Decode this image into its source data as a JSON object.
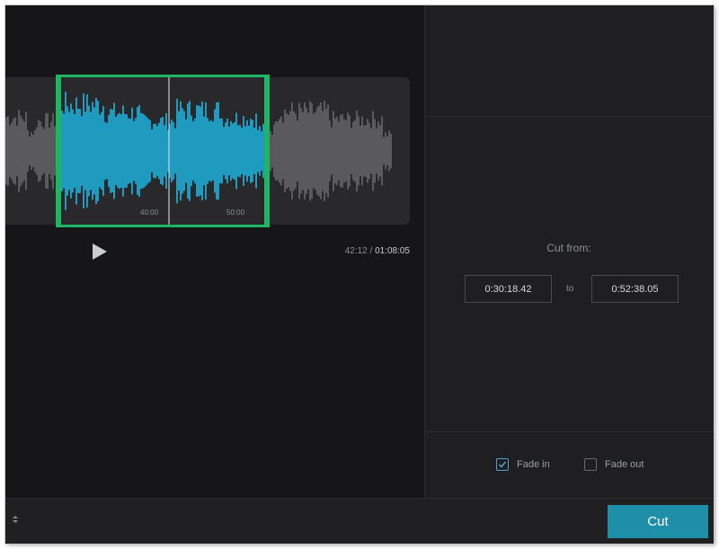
{
  "player": {
    "current_time": "42:12",
    "separator": "/",
    "total_time": "01:08:05",
    "timeline_ticks": [
      "40:00",
      "50:00"
    ]
  },
  "trim": {
    "cut_from_label": "Cut from:",
    "start_value": "0:30:18.42",
    "to_label": "to",
    "end_value": "0:52:38.05"
  },
  "options": {
    "fade_in_label": "Fade in",
    "fade_in_checked": true,
    "fade_out_label": "Fade out",
    "fade_out_checked": false
  },
  "actions": {
    "cut_label": "Cut"
  },
  "colors": {
    "selected_wave": "#1e9bbf",
    "unselected_wave": "#5a5a5c",
    "selection_border": "#1eb563",
    "cut_button": "#1e8fa8"
  },
  "icons": {
    "play": "play-icon",
    "checkbox_checked": "check-icon"
  }
}
